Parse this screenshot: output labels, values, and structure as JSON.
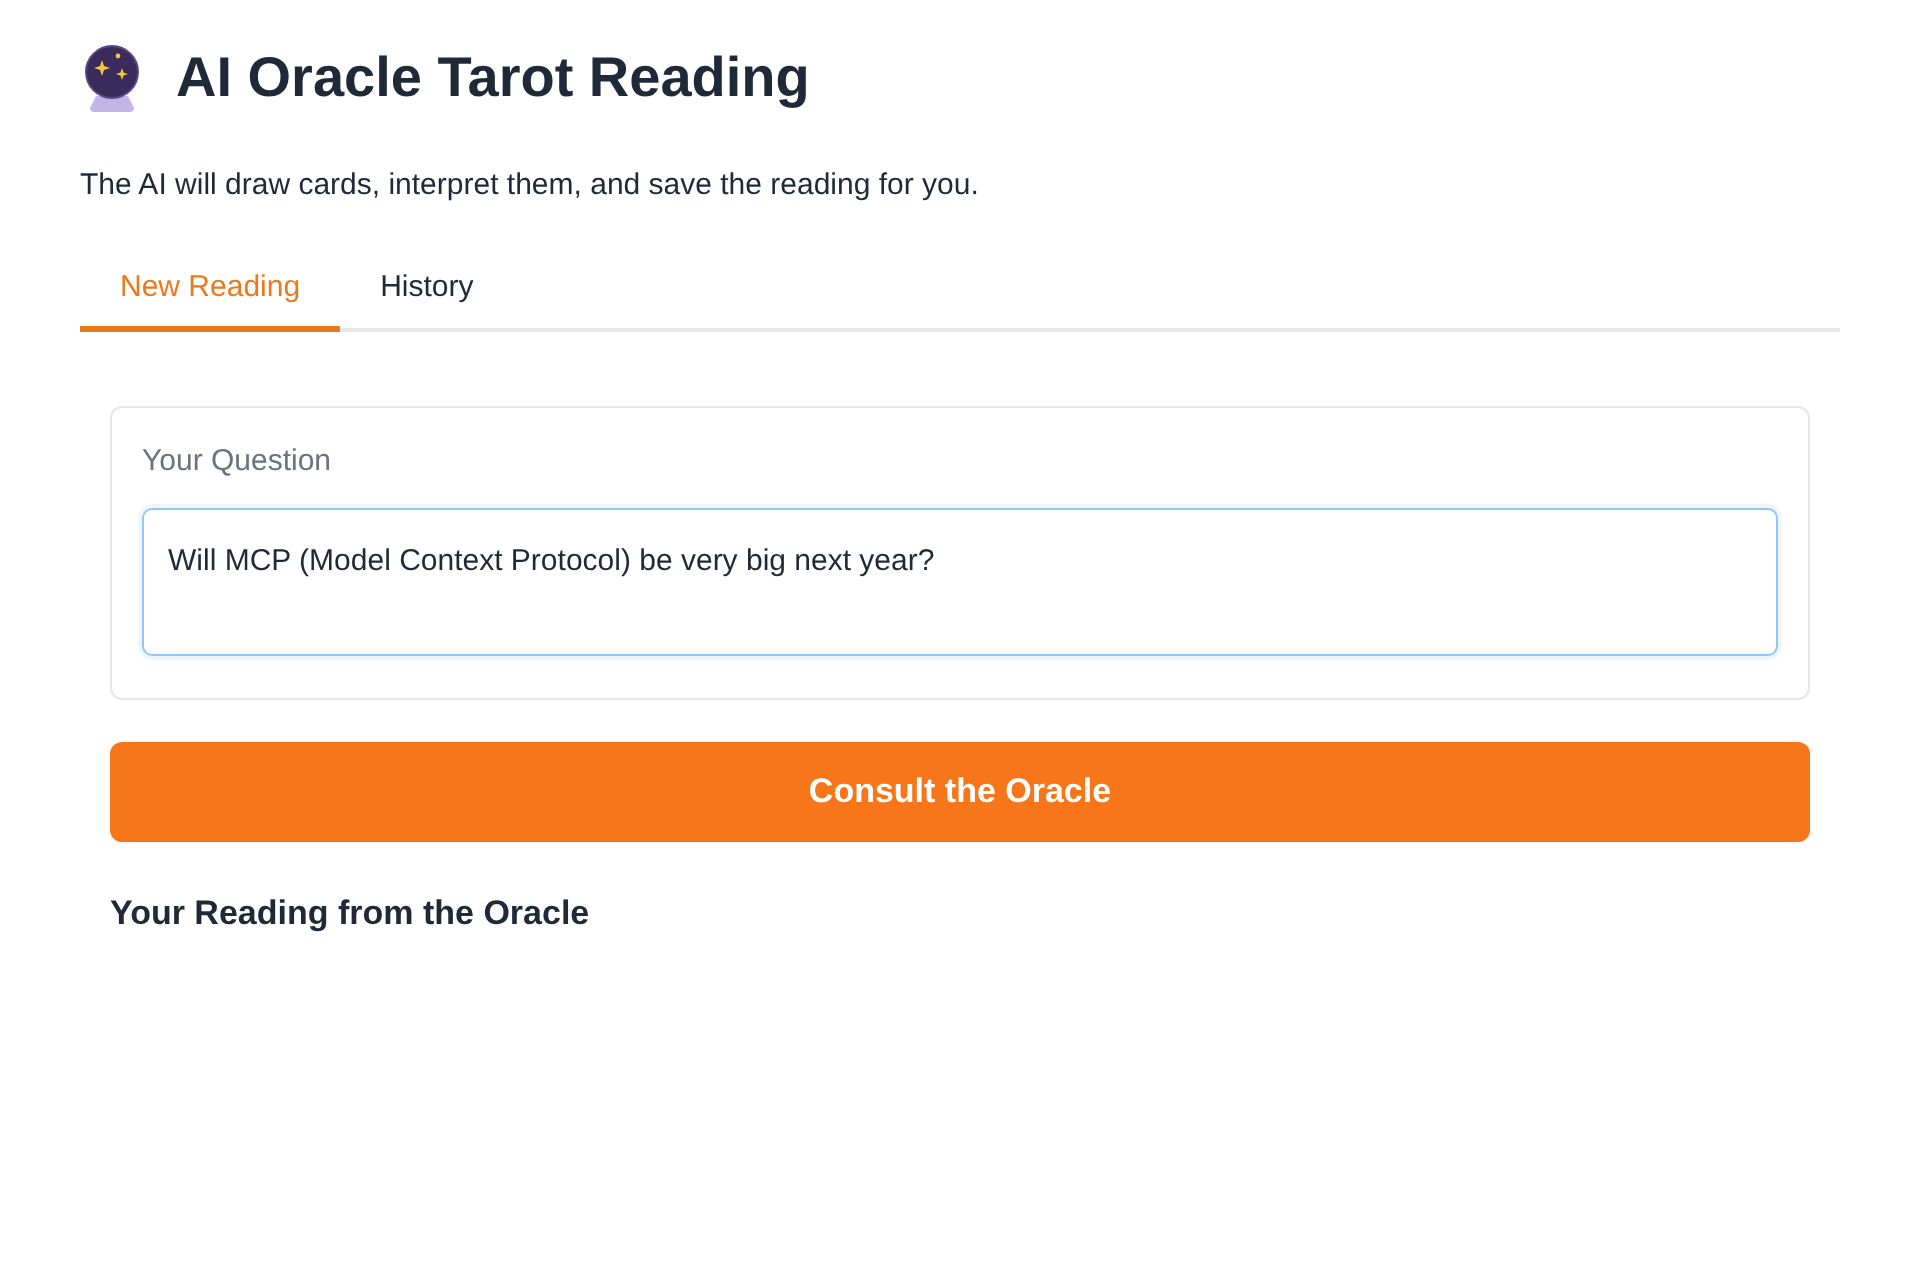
{
  "header": {
    "title": "AI Oracle Tarot Reading",
    "description": "The AI will draw cards, interpret them, and save the reading for you."
  },
  "tabs": [
    {
      "label": "New Reading",
      "selected": true
    },
    {
      "label": "History",
      "selected": false
    }
  ],
  "question": {
    "label": "Your Question",
    "value": "Will MCP (Model Context Protocol) be very big next year?"
  },
  "submit_button": {
    "label": "Consult the Oracle"
  },
  "result": {
    "heading": "Your Reading from the Oracle"
  }
}
